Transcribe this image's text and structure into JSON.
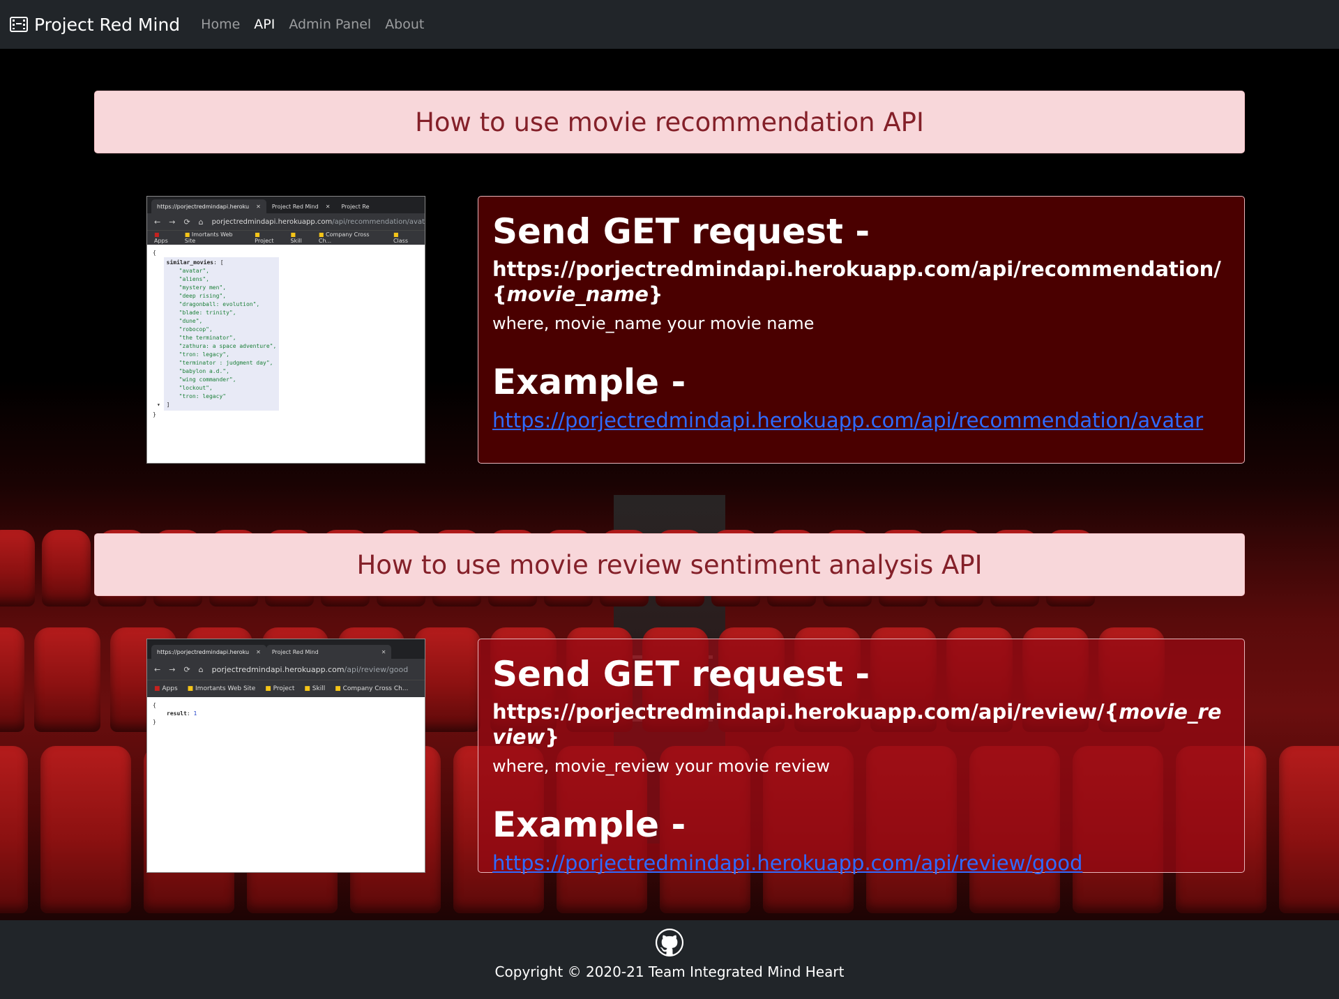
{
  "nav": {
    "brand": "Project Red Mind",
    "links": [
      {
        "label": "Home",
        "active": false
      },
      {
        "label": "API",
        "active": true
      },
      {
        "label": "Admin Panel",
        "active": false
      },
      {
        "label": "About",
        "active": false
      }
    ]
  },
  "sections": [
    {
      "title": "How to use movie recommendation API",
      "screenshot": {
        "tabs": [
          "https://porjectredmindapi.heroku",
          "Project Red Mind",
          "Project Re"
        ],
        "address_host": "porjectredmindapi.herokuapp.com",
        "address_path": "/api/recommendation/avatar",
        "bookmarks": [
          "Apps",
          "Imortants Web Site",
          "Project",
          "Skill",
          "Company Cross Ch...",
          "Class"
        ],
        "json_key": "similar_movies",
        "json_values": [
          "avatar",
          "aliens",
          "mystery men",
          "deep rising",
          "dragonball: evolution",
          "blade: trinity",
          "dune",
          "robocop",
          "the terminator",
          "zathura: a space adventure",
          "tron: legacy",
          "terminator : judgment day",
          "babylon a.d.",
          "wing commander",
          "lockout",
          "tron: legacy"
        ]
      },
      "card": {
        "heading": "Send GET request -",
        "url_prefix": "https://porjectredmindapi.herokuapp.com/api/recommendation/{",
        "url_param": "movie_name",
        "url_suffix": "}",
        "where": "where, movie_name your movie name",
        "example_heading": "Example -",
        "example_link": "https://porjectredmindapi.herokuapp.com/api/recommendation/avatar"
      }
    },
    {
      "title": "How to use movie review sentiment analysis API",
      "screenshot": {
        "tabs": [
          "https://porjectredmindapi.heroku",
          "Project Red Mind"
        ],
        "address_host": "porjectredmindapi.herokuapp.com",
        "address_path": "/api/review/good",
        "bookmarks": [
          "Apps",
          "Imortants Web Site",
          "Project",
          "Skill",
          "Company Cross Ch..."
        ],
        "json_key": "result",
        "json_value": "1"
      },
      "card": {
        "heading": "Send GET request -",
        "url_prefix": "https://porjectredmindapi.herokuapp.com/api/review/{",
        "url_param": "movie_review",
        "url_suffix": "}",
        "where": "where, movie_review your movie review",
        "example_heading": "Example -",
        "example_link": "https://porjectredmindapi.herokuapp.com/api/review/good"
      }
    }
  ],
  "footer": {
    "icon": "github-icon",
    "copyright": "Copyright © 2020-21 Team Integrated Mind Heart"
  }
}
